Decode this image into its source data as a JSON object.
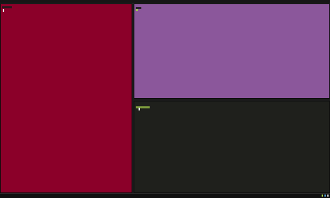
{
  "colors": {
    "pane_left": "#8b0029",
    "pane_top_right": "#8b579b",
    "pane_bottom_right": "#1f201c"
  },
  "panes": {
    "left": {
      "label": ""
    },
    "top_right": {
      "label": ""
    },
    "bottom_right": {
      "path": "",
      "symbol": ""
    }
  },
  "statusbar": {
    "left_text": "",
    "right_items": [
      "",
      "",
      ""
    ]
  }
}
